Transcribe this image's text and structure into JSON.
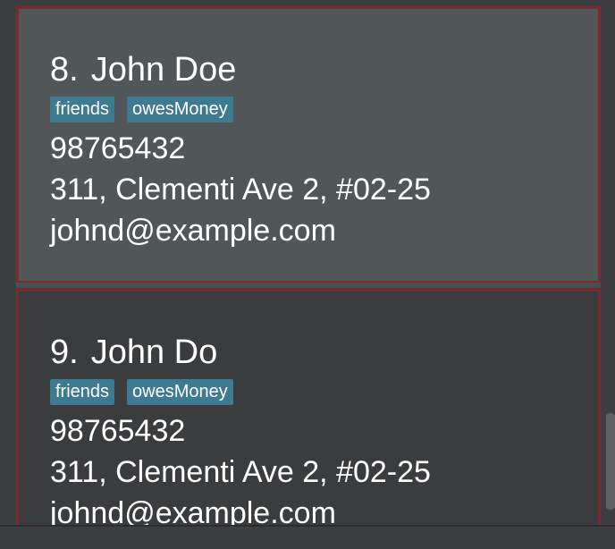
{
  "persons": [
    {
      "index": "8.",
      "name": "John Doe",
      "tags": [
        "friends",
        "owesMoney"
      ],
      "phone": "98765432",
      "address": "311, Clementi Ave 2, #02-25",
      "email": "johnd@example.com"
    },
    {
      "index": "9.",
      "name": "John Do",
      "tags": [
        "friends",
        "owesMoney"
      ],
      "phone": "98765432",
      "address": "311, Clementi Ave 2, #02-25",
      "email": "johnd@example.com"
    }
  ],
  "colors": {
    "card_selected_bg": "#515658",
    "card_bg": "#3b3c3e",
    "card_border": "#7c2a2e",
    "tag_bg": "#3e7b91",
    "text": "#ffffff"
  }
}
